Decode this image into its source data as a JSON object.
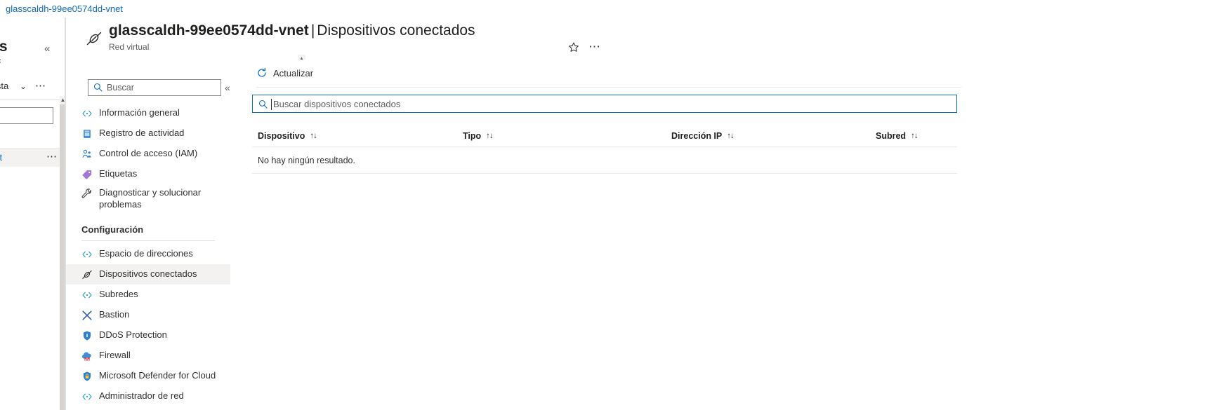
{
  "breadcrumb": {
    "link_label": "glasscaldh-99ee0574dd-vnet"
  },
  "under_blade": {
    "title_fragment": "os",
    "subtitle_fragment": "c",
    "collapse_icon": "chevron-double-left-icon",
    "command_fragment": "ista",
    "chevron_icon": "chevron-down-icon",
    "more_icon": "ellipsis-icon",
    "row_link_fragment": "net",
    "row_more_icon": "ellipsis-icon"
  },
  "header": {
    "resource_icon": "virtual-network-icon",
    "resource_name": "glasscaldh-99ee0574dd-vnet",
    "separator": "|",
    "page_name": "Dispositivos conectados",
    "subtitle": "Red virtual",
    "favorite_icon": "star-outline-icon",
    "more_icon": "ellipsis-icon",
    "accent_color": "#0f6cbd"
  },
  "nav": {
    "search_placeholder": "Buscar",
    "search_value": "",
    "search_icon": "search-icon",
    "collapse_icon": "chevron-double-left-icon",
    "scroll_up_icon": "chevron-up-icon",
    "items": [
      {
        "label": "Información general",
        "icon": "overview-icon",
        "type": "item",
        "selected": false
      },
      {
        "label": "Registro de actividad",
        "icon": "activity-log-icon",
        "type": "item",
        "selected": false
      },
      {
        "label": "Control de acceso (IAM)",
        "icon": "access-control-icon",
        "type": "item",
        "selected": false
      },
      {
        "label": "Etiquetas",
        "icon": "tags-icon",
        "type": "item",
        "selected": false
      },
      {
        "label": "Diagnosticar y solucionar problemas",
        "icon": "wrench-icon",
        "type": "item-tall",
        "selected": false
      },
      {
        "label": "Configuración",
        "icon": "",
        "type": "section",
        "selected": false
      },
      {
        "label": "Espacio de direcciones",
        "icon": "address-space-icon",
        "type": "item",
        "selected": false
      },
      {
        "label": "Dispositivos conectados",
        "icon": "connected-devices-icon",
        "type": "item",
        "selected": true
      },
      {
        "label": "Subredes",
        "icon": "subnets-icon",
        "type": "item",
        "selected": false
      },
      {
        "label": "Bastion",
        "icon": "bastion-icon",
        "type": "item",
        "selected": false
      },
      {
        "label": "DDoS Protection",
        "icon": "ddos-shield-icon",
        "type": "item",
        "selected": false
      },
      {
        "label": "Firewall",
        "icon": "firewall-icon",
        "type": "item",
        "selected": false
      },
      {
        "label": "Microsoft Defender for Cloud",
        "icon": "defender-shield-icon",
        "type": "item",
        "selected": false
      },
      {
        "label": "Administrador de red",
        "icon": "network-manager-icon",
        "type": "item",
        "selected": false
      }
    ]
  },
  "content": {
    "toolbar": {
      "refresh_label": "Actualizar",
      "refresh_icon": "refresh-icon"
    },
    "filter": {
      "placeholder": "Buscar dispositivos conectados",
      "value": "",
      "icon": "search-icon",
      "focused": true
    },
    "table": {
      "columns": [
        {
          "label": "Dispositivo",
          "sort_icon": "sort-updown-icon"
        },
        {
          "label": "Tipo",
          "sort_icon": "sort-updown-icon"
        },
        {
          "label": "Dirección IP",
          "sort_icon": "sort-updown-icon"
        },
        {
          "label": "Subred",
          "sort_icon": "sort-updown-icon"
        }
      ],
      "rows": [],
      "empty_message": "No hay ningún resultado."
    }
  }
}
